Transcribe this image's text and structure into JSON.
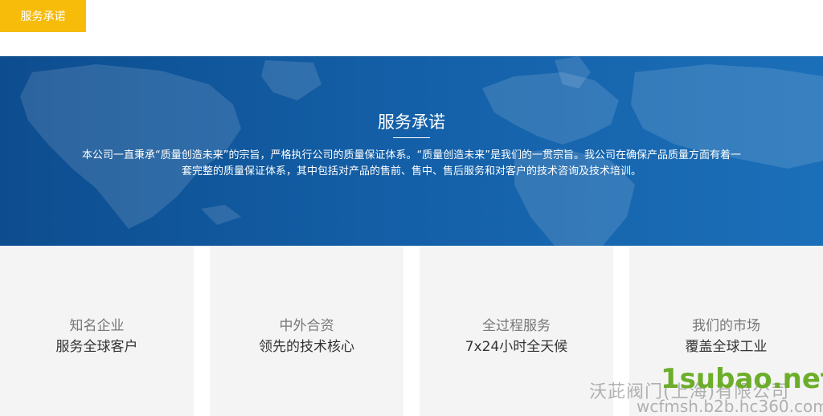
{
  "top_tab": {
    "label": "服务承诺"
  },
  "banner": {
    "title": "服务承诺",
    "description": "本公司一直秉承“质量创造未来”的宗旨，严格执行公司的质量保证体系。“质量创造未来”是我们的一贯宗旨。我公司在确保产品质量方面有着一套完整的质量保证体系，其中包括对产品的售前、售中、售后服务和对客户的技术咨询及技术培训。"
  },
  "cards": [
    {
      "line1": "知名企业",
      "line2": "服务全球客户"
    },
    {
      "line1": "中外合资",
      "line2": "领先的技术核心"
    },
    {
      "line1": "全过程服务",
      "line2": "7x24小时全天候"
    },
    {
      "line1": "我们的市场",
      "line2": "覆盖全球工业"
    }
  ],
  "watermark": {
    "company": "沃茈阀门(上海)有限公司",
    "logo": "1subao.net",
    "url": "wcfmsh.b2b.hc360.com"
  },
  "colors": {
    "tab_bg": "#f7bb0a",
    "banner_blue": "#1460a8",
    "card_bg": "#f4f4f4"
  }
}
